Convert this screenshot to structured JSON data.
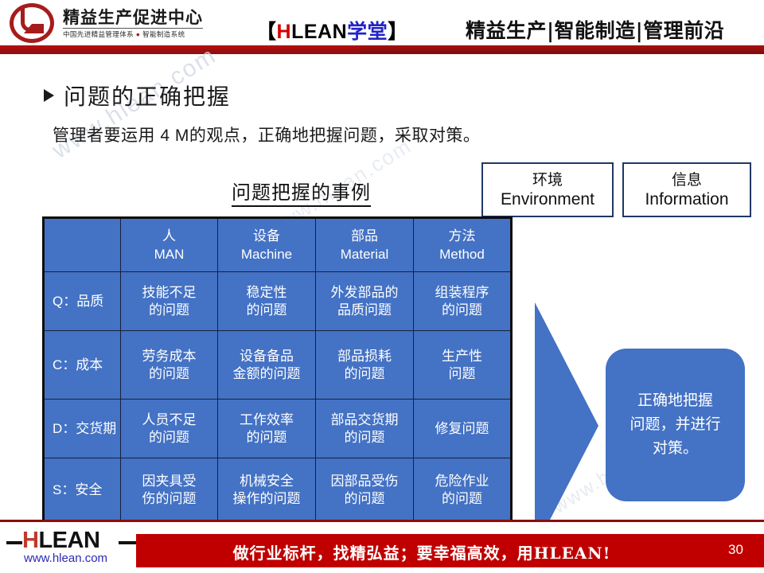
{
  "header": {
    "logo_main": "精益生产促进中心",
    "logo_sub_left": "中国先进精益管理体系",
    "logo_sub_dot": "●",
    "logo_sub_right": "智能制造系统",
    "brand_bracket_open": "【",
    "brand_h": "H",
    "brand_lean": "LEAN",
    "brand_cn": "学堂",
    "brand_bracket_close": "】",
    "tagline": "精益生产|智能制造|管理前沿"
  },
  "slide": {
    "bullet_title": "问题的正确把握",
    "lead_text": "管理者要运用 4 M的观点，正确地把握问题，采取对策。",
    "table_caption": "问题把握的事例",
    "watermark": "www.hlean.com"
  },
  "top_boxes": [
    {
      "cn": "环境",
      "en": "Environment"
    },
    {
      "cn": "信息",
      "en": "Information"
    }
  ],
  "table": {
    "corner": "",
    "columns": [
      {
        "cn": "人",
        "en": "MAN"
      },
      {
        "cn": "设备",
        "en": "Machine"
      },
      {
        "cn": "部品",
        "en": "Material"
      },
      {
        "cn": "方法",
        "en": "Method"
      }
    ],
    "rows": [
      {
        "head": "Q：品质",
        "cells": [
          "技能不足\n的问题",
          "稳定性\n的问题",
          "外发部品的\n品质问题",
          "组装程序\n的问题"
        ]
      },
      {
        "head": "C：成本",
        "cells": [
          "劳务成本\n的问题",
          "设备备品\n金额的问题",
          "部品损耗\n的问题",
          "生产性\n问题"
        ]
      },
      {
        "head": "D：交货期",
        "cells": [
          "人员不足\n的问题",
          "工作效率\n的问题",
          "部品交货期\n的问题",
          "修复问题"
        ]
      },
      {
        "head": "S：安全",
        "cells": [
          "因夹具受\n伤的问题",
          "机械安全\n操作的问题",
          "因部品受伤\n的问题",
          "危险作业\n的问题"
        ]
      }
    ]
  },
  "callout": {
    "text": "正确地把握\n问题，并进行\n对策。"
  },
  "footer": {
    "logo_h": "H",
    "logo_rest": "LEAN",
    "url": "www.hlean.com",
    "slogan": "做行业标杆，找精弘益；要幸福高效，用HLEAN!",
    "page_number": "30"
  },
  "colors": {
    "brand_red": "#c00000",
    "header_bar": "#8d0d0d",
    "table_blue": "#4472c4",
    "box_border": "#1f3864",
    "link_blue": "#2b2bb5"
  }
}
